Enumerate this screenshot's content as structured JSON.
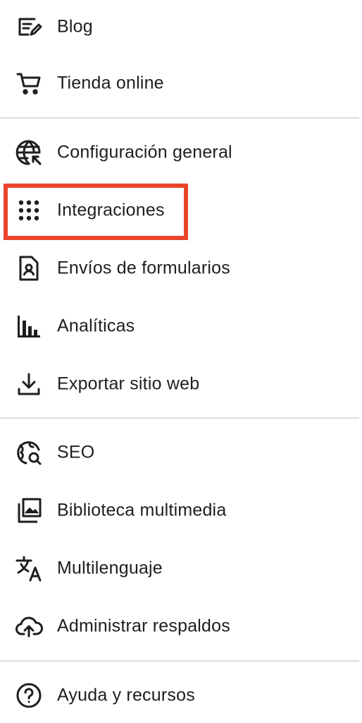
{
  "menu": {
    "items": [
      {
        "label": "Blog",
        "icon": "blog-edit-icon"
      },
      {
        "label": "Tienda online",
        "icon": "shopping-cart-icon"
      },
      {
        "label": "Configuración general",
        "icon": "globe-settings-icon"
      },
      {
        "label": "Integraciones",
        "icon": "grid-dots-icon"
      },
      {
        "label": "Envíos de formularios",
        "icon": "form-submission-icon"
      },
      {
        "label": "Analíticas",
        "icon": "bar-chart-icon"
      },
      {
        "label": "Exportar sitio web",
        "icon": "download-icon"
      },
      {
        "label": "SEO",
        "icon": "globe-search-icon"
      },
      {
        "label": "Biblioteca multimedia",
        "icon": "media-library-icon"
      },
      {
        "label": "Multilenguaje",
        "icon": "translate-icon"
      },
      {
        "label": "Administrar respaldos",
        "icon": "cloud-upload-icon"
      },
      {
        "label": "Ayuda y recursos",
        "icon": "help-circle-icon"
      }
    ],
    "highlighted_item": "Integraciones"
  },
  "colors": {
    "text": "#1d1e20",
    "highlight": "#e8452c",
    "divider": "#dadce0"
  }
}
